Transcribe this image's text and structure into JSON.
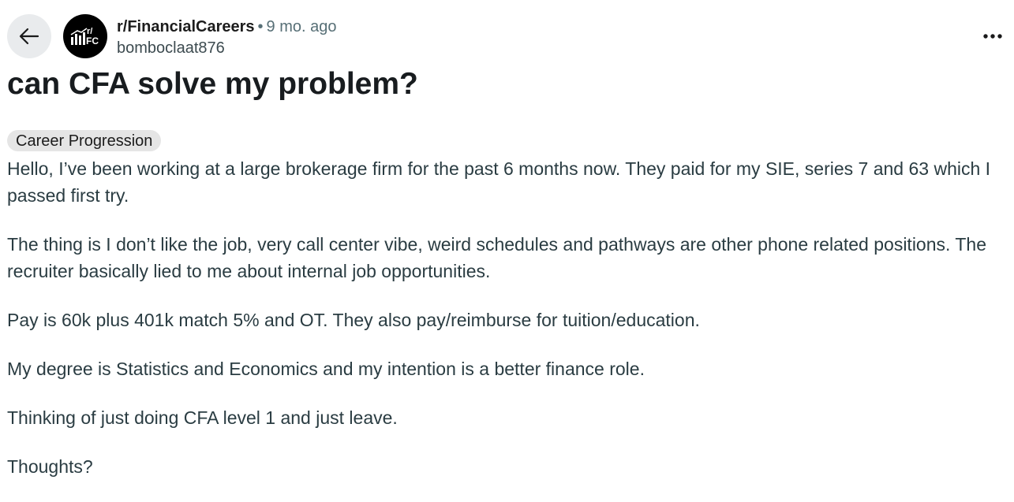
{
  "header": {
    "subreddit": "r/FinancialCareers",
    "separator": "•",
    "age": "9 mo. ago",
    "author": "bomboclaat876",
    "avatar_text": "r/FC",
    "back_icon": "arrow-left-icon",
    "more_icon": "ellipsis-horizontal-icon"
  },
  "post": {
    "title": "can CFA solve my problem?",
    "flair": "Career Progression",
    "paragraphs": [
      "Hello, I’ve been working at a large brokerage firm for the past 6 months now. They paid for my SIE, series 7 and 63 which I passed first try.",
      "The thing is I don’t like the job, very call center vibe, weird schedules and pathways are other phone related positions. The recruiter basically lied to me about internal job opportunities.",
      "Pay is 60k plus 401k match 5% and OT. They also pay/reimburse for tuition/education.",
      "My degree is Statistics and Economics and my intention is a better finance role.",
      "Thinking of just doing CFA level 1 and just leave.",
      "Thoughts?"
    ]
  },
  "colors": {
    "background": "#ffffff",
    "back_button_bg": "#e9ebed",
    "flair_bg": "#e5e5e5",
    "meta_gray": "#576f76",
    "body_text": "#2a3c42",
    "avatar_bg": "#000000"
  }
}
